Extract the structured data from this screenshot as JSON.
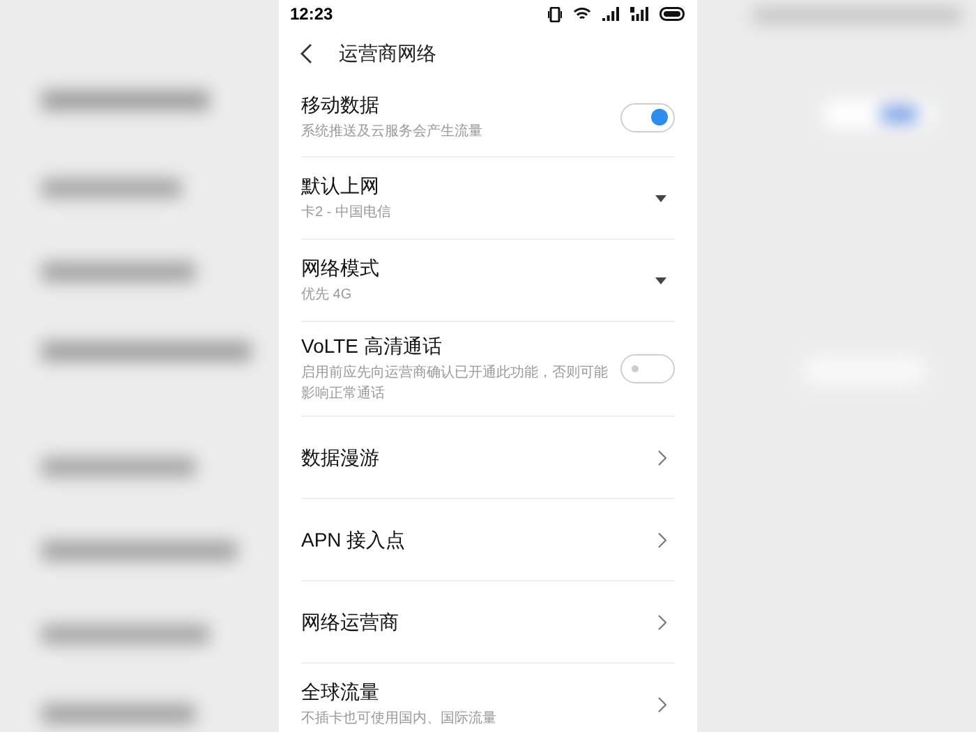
{
  "status_bar": {
    "time": "12:23"
  },
  "header": {
    "title": "运营商网络"
  },
  "items": [
    {
      "kind": "toggle",
      "title": "移动数据",
      "subtitle": "系统推送及云服务会产生流量",
      "on": true
    },
    {
      "kind": "dropdown",
      "title": "默认上网",
      "subtitle": "卡2 - 中国电信"
    },
    {
      "kind": "dropdown",
      "title": "网络模式",
      "subtitle": "优先 4G"
    },
    {
      "kind": "toggle",
      "title": "VoLTE 高清通话",
      "subtitle": "启用前应先向运营商确认已开通此功能，否则可能影响正常通话",
      "on": false
    },
    {
      "kind": "link",
      "title": "数据漫游"
    },
    {
      "kind": "link",
      "title": "APN 接入点"
    },
    {
      "kind": "link",
      "title": "网络运营商"
    },
    {
      "kind": "link",
      "title": "全球流量",
      "subtitle": "不插卡也可使用国内、国际流量"
    }
  ]
}
